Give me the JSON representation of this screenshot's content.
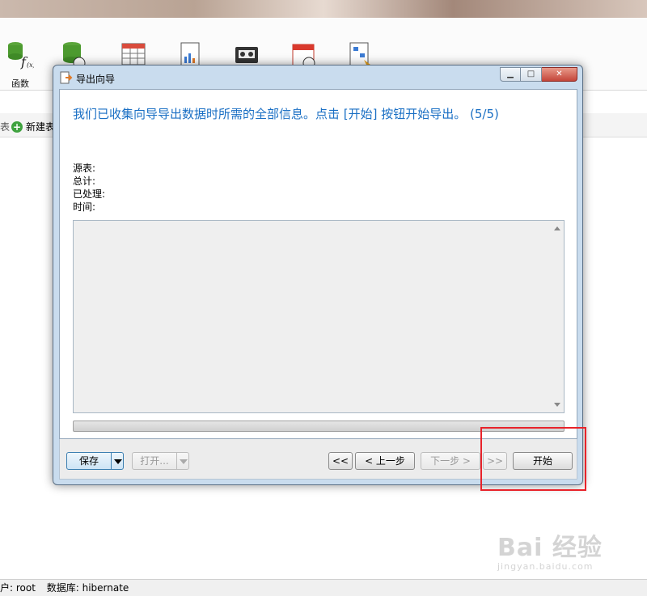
{
  "app": {
    "toolbar": [
      {
        "label": "函数",
        "icon": "function-icon"
      },
      {
        "label": "",
        "icon": "event-icon"
      },
      {
        "label": "",
        "icon": "table-icon"
      },
      {
        "label": "",
        "icon": "report-icon"
      },
      {
        "label": "",
        "icon": "backup-icon"
      },
      {
        "label": "",
        "icon": "schedule-icon"
      },
      {
        "label": "",
        "icon": "model-icon"
      }
    ],
    "object_bar": {
      "left_fragment": "表",
      "new_table_label": "新建表"
    },
    "status": {
      "user": "户: root",
      "database": "数据库: hibernate"
    }
  },
  "dialog": {
    "title": "导出向导",
    "window_buttons": {
      "minimize": "▁",
      "maximize": "□",
      "close": "✕"
    },
    "headline": "我们已收集向导导出数据时所需的全部信息。点击 [开始] 按钮开始导出。 (5/5)",
    "info_lines": [
      "源表:",
      "总计:",
      "已处理:",
      "时间:"
    ],
    "log_text": "",
    "progress_percent": 0,
    "footer": {
      "save": "保存",
      "open": "打开...",
      "first": "<<",
      "back": "< 上一步",
      "next": "下一步 >",
      "last": ">>",
      "start": "开始"
    }
  },
  "watermark": {
    "big": "Bai 经验",
    "small": "jingyan.baidu.com"
  },
  "colors": {
    "headline": "#1a6fc4",
    "highlight": "#e8232a",
    "close_button": "#c4453a"
  }
}
